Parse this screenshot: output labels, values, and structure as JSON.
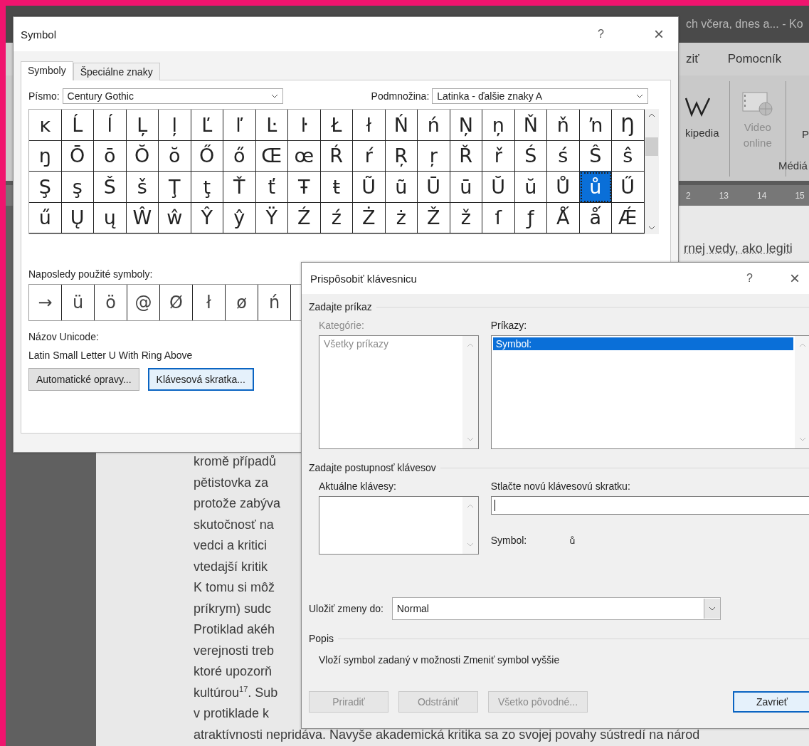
{
  "word": {
    "title": "ch včera, dnes a... - Ko",
    "ribbon_tabs": [
      "ziť",
      "Pomocník"
    ],
    "ribbon_items": [
      {
        "kind": "wikipedia",
        "label": "kipedia",
        "disabled": false
      },
      {
        "kind": "video",
        "label": "Video online",
        "disabled": true
      },
      {
        "kind": "cut",
        "label": "P",
        "disabled": false
      }
    ],
    "group_label": "Médiá",
    "ruler": [
      "2",
      "13",
      "14",
      "15"
    ],
    "right_line": "rnej vedy, ako legiti",
    "document_lines": [
      "kromě případů",
      "pětistovka za",
      "protože zabýva",
      "skutočnosť na",
      "vedci a kritici",
      "vtedajší kritik",
      "K tomu si môž",
      "príkrym) sudc",
      "Protiklad akéh",
      "verejnosti treb",
      "ktoré upozorň",
      "kultúrou$^{17}$. Sub",
      "v protiklade k",
      "atraktívnosti nepridáva. Navyše akademická kritika sa zo svojej povahy sústredí na národ"
    ]
  },
  "symbol_dialog": {
    "title": "Symbol",
    "help": "?",
    "close": "×",
    "tabs": [
      {
        "label": "Symboly",
        "selected": true
      },
      {
        "label": "Špeciálne znaky",
        "selected": false
      }
    ],
    "font_label": "Písmo:",
    "font": "Century Gothic",
    "subset_label": "Podmnožina:",
    "subset": "Latinka - ďalšie znaky A",
    "symbol_rows": [
      [
        {
          "c": "ĸ",
          "selected": false
        },
        {
          "c": "Ĺ",
          "selected": false
        },
        {
          "c": "ĺ",
          "selected": false
        },
        {
          "c": "Ļ",
          "selected": false
        },
        {
          "c": "ļ",
          "selected": false
        },
        {
          "c": "Ľ",
          "selected": false
        },
        {
          "c": "ľ",
          "selected": false
        },
        {
          "c": "Ŀ",
          "selected": false
        },
        {
          "c": "ŀ",
          "selected": false
        },
        {
          "c": "Ł",
          "selected": false
        },
        {
          "c": "ł",
          "selected": false
        },
        {
          "c": "Ń",
          "selected": false
        },
        {
          "c": "ń",
          "selected": false
        },
        {
          "c": "Ņ",
          "selected": false
        },
        {
          "c": "ņ",
          "selected": false
        },
        {
          "c": "Ň",
          "selected": false
        },
        {
          "c": "ň",
          "selected": false
        },
        {
          "c": "ŉ",
          "selected": false
        },
        {
          "c": "Ŋ",
          "selected": false
        }
      ],
      [
        {
          "c": "ŋ",
          "selected": false
        },
        {
          "c": "Ō",
          "selected": false
        },
        {
          "c": "ō",
          "selected": false
        },
        {
          "c": "Ŏ",
          "selected": false
        },
        {
          "c": "ŏ",
          "selected": false
        },
        {
          "c": "Ő",
          "selected": false
        },
        {
          "c": "ő",
          "selected": false
        },
        {
          "c": "Œ",
          "selected": false
        },
        {
          "c": "œ",
          "selected": false
        },
        {
          "c": "Ŕ",
          "selected": false
        },
        {
          "c": "ŕ",
          "selected": false
        },
        {
          "c": "Ŗ",
          "selected": false
        },
        {
          "c": "ŗ",
          "selected": false
        },
        {
          "c": "Ř",
          "selected": false
        },
        {
          "c": "ř",
          "selected": false
        },
        {
          "c": "Ś",
          "selected": false
        },
        {
          "c": "ś",
          "selected": false
        },
        {
          "c": "Ŝ",
          "selected": false
        },
        {
          "c": "ŝ",
          "selected": false
        }
      ],
      [
        {
          "c": "Ş",
          "selected": false
        },
        {
          "c": "ş",
          "selected": false
        },
        {
          "c": "Š",
          "selected": false
        },
        {
          "c": "š",
          "selected": false
        },
        {
          "c": "Ţ",
          "selected": false
        },
        {
          "c": "ţ",
          "selected": false
        },
        {
          "c": "Ť",
          "selected": false
        },
        {
          "c": "ť",
          "selected": false
        },
        {
          "c": "Ŧ",
          "selected": false
        },
        {
          "c": "ŧ",
          "selected": false
        },
        {
          "c": "Ũ",
          "selected": false
        },
        {
          "c": "ũ",
          "selected": false
        },
        {
          "c": "Ū",
          "selected": false
        },
        {
          "c": "ū",
          "selected": false
        },
        {
          "c": "Ŭ",
          "selected": false
        },
        {
          "c": "ŭ",
          "selected": false
        },
        {
          "c": "Ů",
          "selected": false
        },
        {
          "c": "ů",
          "selected": true
        },
        {
          "c": "Ű",
          "selected": false
        }
      ],
      [
        {
          "c": "ű",
          "selected": false
        },
        {
          "c": "Ų",
          "selected": false
        },
        {
          "c": "ų",
          "selected": false
        },
        {
          "c": "Ŵ",
          "selected": false
        },
        {
          "c": "ŵ",
          "selected": false
        },
        {
          "c": "Ŷ",
          "selected": false
        },
        {
          "c": "ŷ",
          "selected": false
        },
        {
          "c": "Ÿ",
          "selected": false
        },
        {
          "c": "Ź",
          "selected": false
        },
        {
          "c": "ź",
          "selected": false
        },
        {
          "c": "Ż",
          "selected": false
        },
        {
          "c": "ż",
          "selected": false
        },
        {
          "c": "Ž",
          "selected": false
        },
        {
          "c": "ž",
          "selected": false
        },
        {
          "c": "ſ",
          "selected": false
        },
        {
          "c": "ƒ",
          "selected": false
        },
        {
          "c": "Ǻ",
          "selected": false
        },
        {
          "c": "ǻ",
          "selected": false
        },
        {
          "c": "Ǽ",
          "selected": false
        }
      ]
    ],
    "recent_label": "Naposledy použité symboly:",
    "recent": [
      "→",
      "ü",
      "ö",
      "@",
      "Ø",
      "ł",
      "ø",
      "ń"
    ],
    "unicode_label": "Názov Unicode:",
    "unicode_name": "Latin Small Letter U With Ring Above",
    "buttons": [
      {
        "label": "Automatické opravy...",
        "default": false
      },
      {
        "label": "Klávesová skratka...",
        "default": true
      }
    ]
  },
  "customize_dialog": {
    "title": "Prispôsobiť klávesnicu",
    "help": "?",
    "close": "×",
    "command_section": "Zadajte príkaz",
    "categories": {
      "label": "Kategórie:",
      "disabled": true,
      "items": [
        {
          "label": "Všetky príkazy",
          "selected": false
        }
      ]
    },
    "commands": {
      "label": "Príkazy:",
      "disabled": false,
      "items": [
        {
          "label": "Symbol:",
          "selected": true
        }
      ]
    },
    "keys_section": "Zadajte postupnosť klávesov",
    "current_keys_label": "Aktuálne klávesy:",
    "new_key_label": "Stlačte novú klávesovú skratku:",
    "symbol_label": "Symbol:",
    "symbol_preview": "ů",
    "save_label": "Uložiť zmeny do:",
    "save_value": "Normal",
    "description_title": "Popis",
    "description": "Vloží symbol zadaný v možnosti Zmeniť symbol vyššie",
    "buttons": [
      {
        "label": "Priradiť",
        "disabled": true,
        "default": false
      },
      {
        "label": "Odstrániť",
        "disabled": true,
        "default": false
      },
      {
        "label": "Všetko pôvodné...",
        "disabled": true,
        "default": false
      },
      {
        "label": "Zavrieť",
        "disabled": false,
        "default": true
      }
    ]
  }
}
